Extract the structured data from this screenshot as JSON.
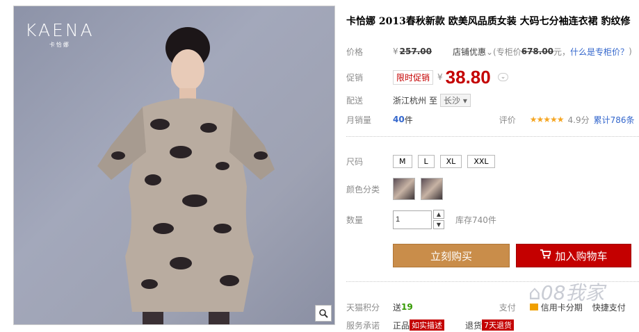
{
  "brand": {
    "logo": "KAENA",
    "sub": "卡恰娜"
  },
  "title": "卡恰娜 2013春秋新款 欧美风品质女装 大码七分袖连衣裙 豹纹修",
  "price": {
    "label": "价格",
    "value": "257.00",
    "discount_label": "店铺优惠",
    "counter_label": "(专柜价",
    "counter_value": "678.00",
    "suffix": "元，",
    "help": "什么是专柜价？",
    "close": ")"
  },
  "promo": {
    "label": "促销",
    "tag": "限时促销",
    "currency": "¥",
    "value": "38.80"
  },
  "shipping": {
    "label": "配送",
    "from": "浙江杭州",
    "to": "至",
    "city": "长沙"
  },
  "sales": {
    "label": "月销量",
    "count": "40",
    "unit": "件",
    "rating_label": "评价",
    "stars": "★★★★★",
    "score": "4.9分",
    "total": "累计786条"
  },
  "size": {
    "label": "尺码",
    "options": [
      "M",
      "L",
      "XL",
      "XXL"
    ]
  },
  "color": {
    "label": "颜色分类"
  },
  "quantity": {
    "label": "数量",
    "value": "1",
    "stock": "库存740件"
  },
  "buttons": {
    "buy": "立刻购买",
    "cart": "加入购物车"
  },
  "bottom": {
    "points_label": "天猫积分",
    "points_prefix": "送",
    "points": "19",
    "pay_label": "支付",
    "pay_credit": "信用卡分期",
    "pay_fast": "快捷支付",
    "service_label": "服务承诺",
    "service1": "正品",
    "service2": "如实描述",
    "service3": "退货",
    "service4": "7天退货",
    "watermark": "08我家"
  }
}
